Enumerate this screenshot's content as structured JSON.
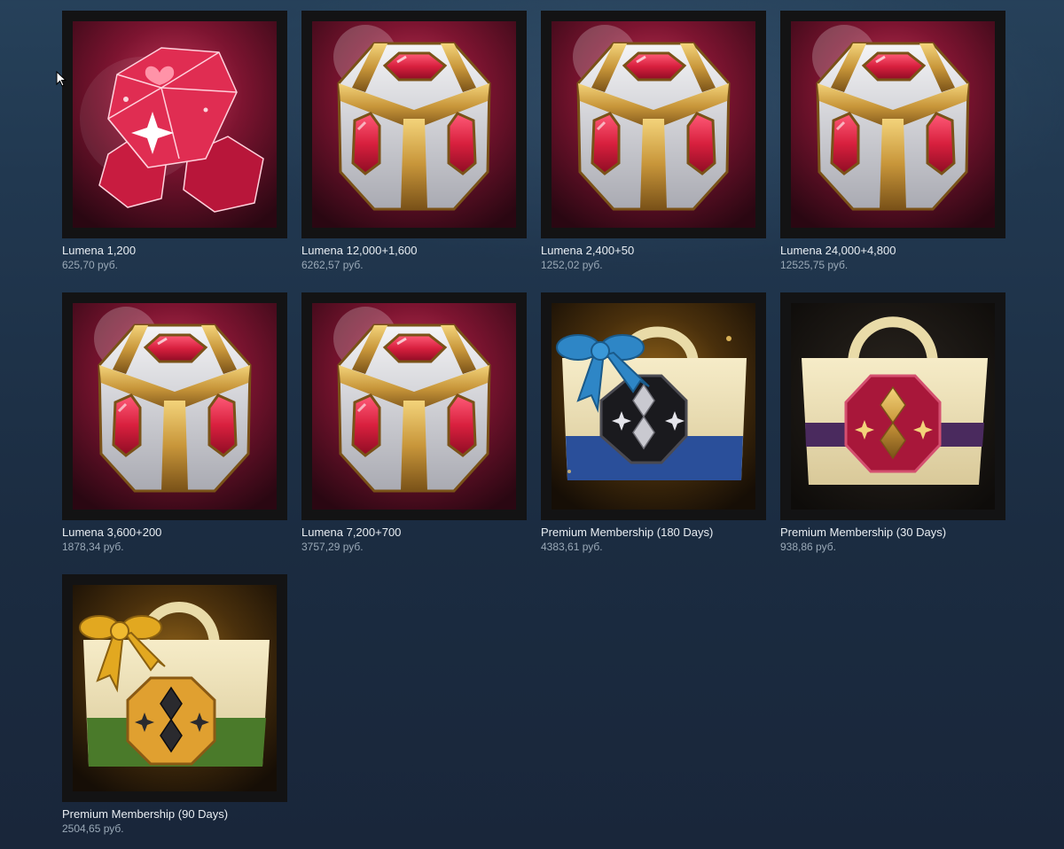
{
  "store": {
    "items": [
      {
        "title": "Lumena 1,200",
        "price": "625,70 руб.",
        "icon": "gems-pile-icon"
      },
      {
        "title": "Lumena 12,000+1,600",
        "price": "6262,57 руб.",
        "icon": "gem-chest-icon"
      },
      {
        "title": "Lumena 2,400+50",
        "price": "1252,02 руб.",
        "icon": "gem-chest-icon"
      },
      {
        "title": "Lumena 24,000+4,800",
        "price": "12525,75 руб.",
        "icon": "gem-chest-icon"
      },
      {
        "title": "Lumena 3,600+200",
        "price": "1878,34 руб.",
        "icon": "gem-chest-icon"
      },
      {
        "title": "Lumena 7,200+700",
        "price": "3757,29 руб.",
        "icon": "gem-chest-icon"
      },
      {
        "title": "Premium Membership (180 Days)",
        "price": "4383,61 руб.",
        "icon": "gift-bag-blue-icon"
      },
      {
        "title": "Premium Membership (30 Days)",
        "price": "938,86 руб.",
        "icon": "bag-crimson-icon"
      },
      {
        "title": "Premium Membership (90 Days)",
        "price": "2504,65 руб.",
        "icon": "gift-bag-gold-icon"
      }
    ]
  },
  "colors": {
    "page_bg": "#1b2c41",
    "frame_bg": "#131314",
    "title_text": "#e8edf2",
    "price_text": "#9aa9b7",
    "gem_red": "#d8203e"
  }
}
